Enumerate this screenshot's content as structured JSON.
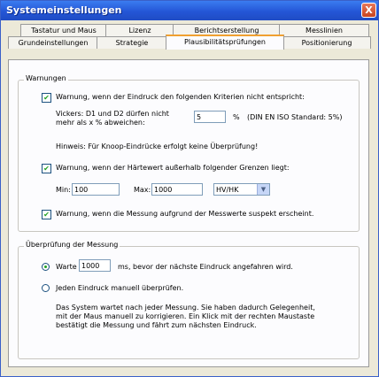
{
  "window": {
    "title": "Systemeinstellungen",
    "close_glyph": "X"
  },
  "tabs_row1": [
    "Tastatur und Maus",
    "Lizenz",
    "Berichtserstellung",
    "Messlinien"
  ],
  "tabs_row2": [
    "Grundeinstellungen",
    "Strategie",
    "Plausibilitätsprüfungen",
    "Positionierung"
  ],
  "active_tab": "Plausibilitätsprüfungen",
  "warnings": {
    "legend": "Warnungen",
    "criteria_check": {
      "checked": true,
      "label": "Warnung, wenn der Eindruck den folgenden Kriterien nicht entspricht:"
    },
    "vickers_line1": "Vickers: D1 und D2 dürfen nicht",
    "vickers_line2": "mehr als x % abweichen:",
    "vickers_value": "5",
    "vickers_unit": "%",
    "vickers_standard": "(DIN EN ISO Standard: 5%)",
    "knoop_hint": "Hinweis: Für Knoop-Eindrücke erfolgt keine Überprüfung!",
    "hardness_check": {
      "checked": true,
      "label": "Warnung, wenn der Härtewert außerhalb folgender Grenzen liegt:"
    },
    "min_label": "Min:",
    "min_value": "100",
    "max_label": "Max:",
    "max_value": "1000",
    "unit_select": "HV/HK",
    "suspect_check": {
      "checked": true,
      "label": "Warnung, wenn die Messung aufgrund der Messwerte suspekt erscheint."
    }
  },
  "measurement": {
    "legend": "Überprüfung der Messung",
    "wait_radio": {
      "selected": true,
      "label": "Warte"
    },
    "wait_value": "1000",
    "wait_suffix": "ms, bevor der nächste Eindruck angefahren wird.",
    "manual_radio": {
      "selected": false,
      "label": "Jeden Eindruck manuell überprüfen."
    },
    "desc_line1": "Das System wartet nach jeder Messung. Sie haben dadurch Gelegenheit,",
    "desc_line2": "mit der Maus manuell zu korrigieren. Ein Klick mit der rechten Maustaste",
    "desc_line3": "bestätigt die Messung und fährt zum nächsten Eindruck."
  },
  "glyphs": {
    "check": "✔",
    "dropdown": "▼"
  }
}
